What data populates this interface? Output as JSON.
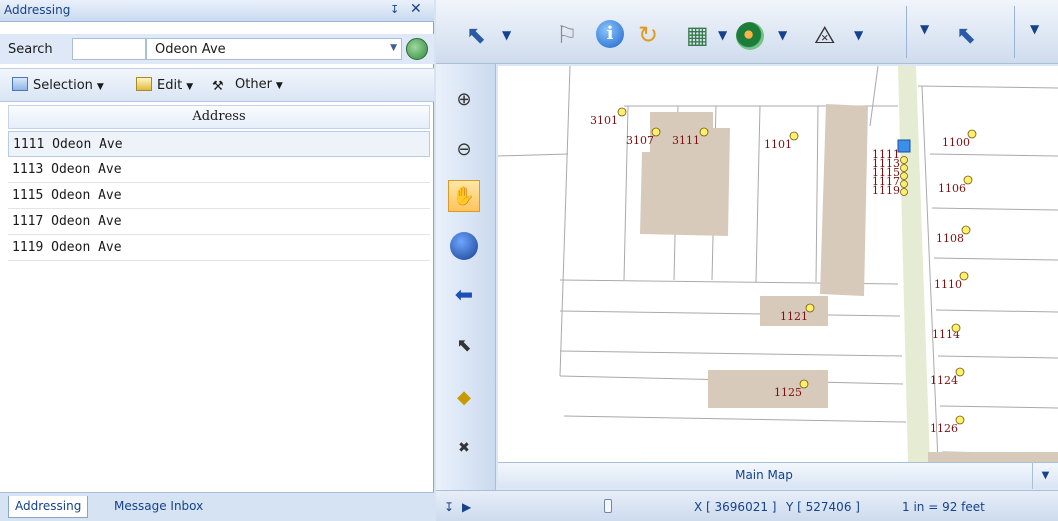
{
  "left_panel": {
    "title": "Addressing",
    "search_label": "Search",
    "search_value": "",
    "street_value": "Odeon Ave",
    "menu": {
      "selection": "Selection",
      "edit": "Edit",
      "other": "Other"
    },
    "grid": {
      "header": "Address",
      "rows": [
        "1111 Odeon Ave",
        "1113 Odeon Ave",
        "1115 Odeon Ave",
        "1117 Odeon Ave",
        "1119 Odeon Ave"
      ]
    },
    "tabs": {
      "addressing": "Addressing",
      "inbox": "Message Inbox"
    }
  },
  "map": {
    "labels": [
      "3101",
      "3107",
      "3111",
      "1101",
      "1111",
      "1113",
      "1115",
      "1117",
      "1119",
      "1100",
      "1106",
      "1108",
      "1110",
      "1121",
      "1114",
      "1124",
      "1125",
      "1126"
    ],
    "map_selector": "Main Map"
  },
  "status": {
    "x": "X [ 3696021 ]",
    "y": "Y [ 527406 ]",
    "scale": "1 in = 92 feet"
  },
  "colors": {
    "accent": "#15428b",
    "parcel": "#d8cabb",
    "road": "#e6ecd3",
    "address_text": "#7a1010"
  }
}
